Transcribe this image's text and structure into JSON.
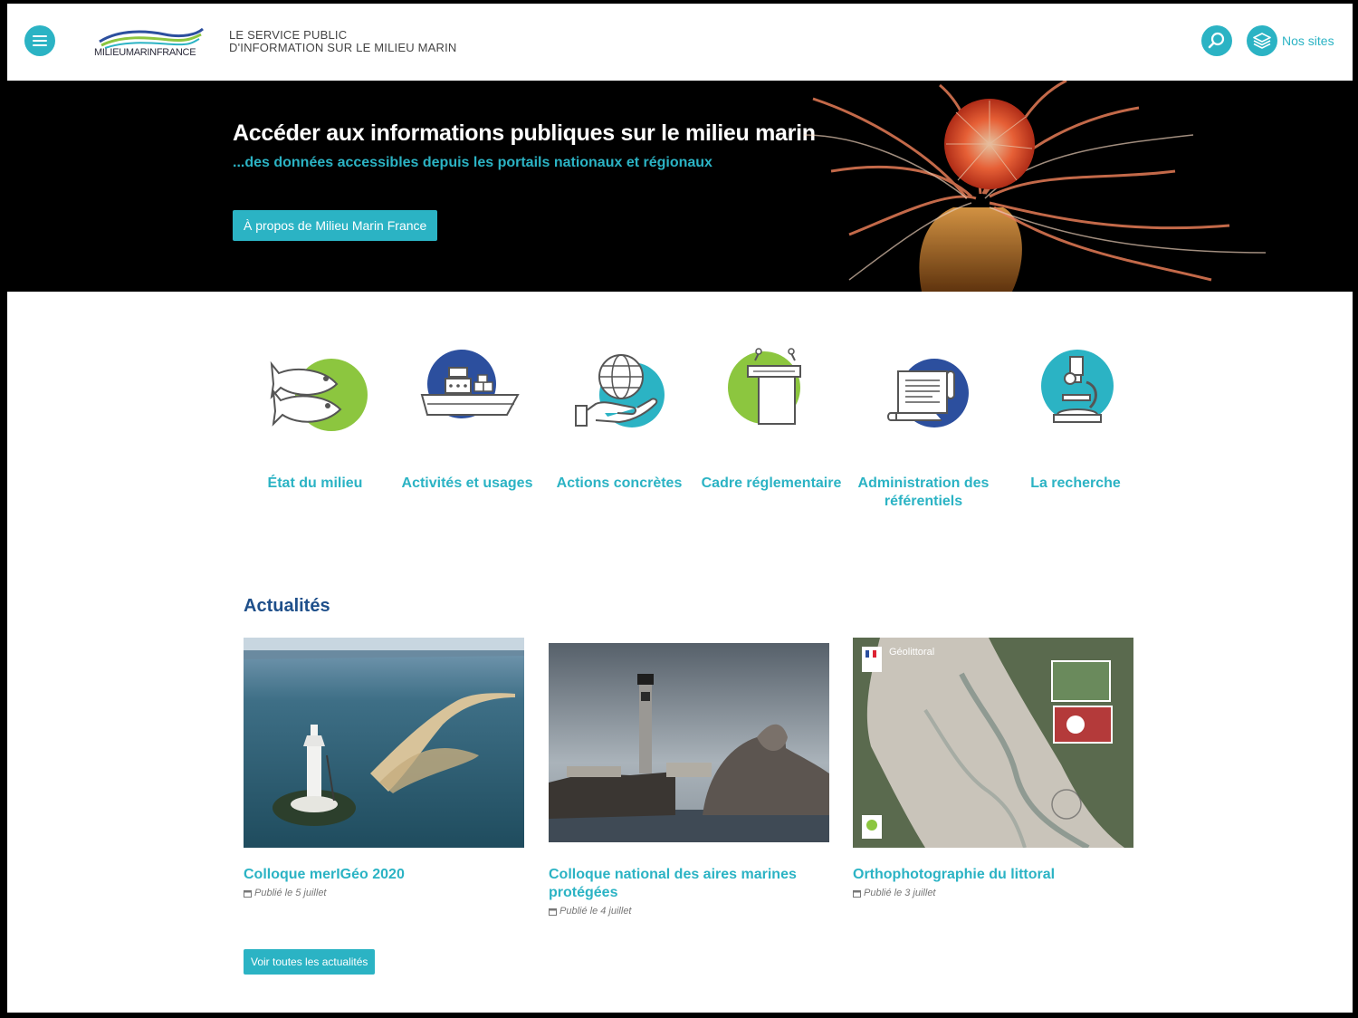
{
  "header": {
    "logo_text": "MILIEUMARINFRANCE",
    "tagline_line1": "LE SERVICE PUBLIC",
    "tagline_line2": "D'INFORMATION SUR LE MILIEU MARIN",
    "sites_label": "Nos sites"
  },
  "hero": {
    "title": "Accéder aux informations publiques sur le milieu marin",
    "subtitle": "...des données accessibles depuis les portails nationaux et régionaux",
    "button_label": "À propos de Milieu Marin France"
  },
  "themes": [
    {
      "label": "État du milieu",
      "icon": "fish-icon"
    },
    {
      "label": "Activités et usages",
      "icon": "ship-icon"
    },
    {
      "label": "Actions concrètes",
      "icon": "globe-hand-icon"
    },
    {
      "label": "Cadre réglementaire",
      "icon": "podium-icon"
    },
    {
      "label": "Administration des référentiels",
      "icon": "scroll-icon"
    },
    {
      "label": "La recherche",
      "icon": "microscope-icon"
    }
  ],
  "news": {
    "section_title": "Actualités",
    "items": [
      {
        "title": "Colloque merIGéo 2020",
        "date": "Publié le 5 juillet"
      },
      {
        "title": "Colloque national des aires marines protégées",
        "date": "Publié le 4 juillet"
      },
      {
        "title": "Orthophotographie du littoral",
        "date": "Publié le 3 juillet",
        "image_caption": "Géolittoral"
      }
    ],
    "all_button_label": "Voir toutes les actualités"
  },
  "colors": {
    "accent": "#2bb3c4",
    "green": "#8cc63f",
    "blue": "#2c4f9e",
    "title_blue": "#1e4f8a"
  }
}
